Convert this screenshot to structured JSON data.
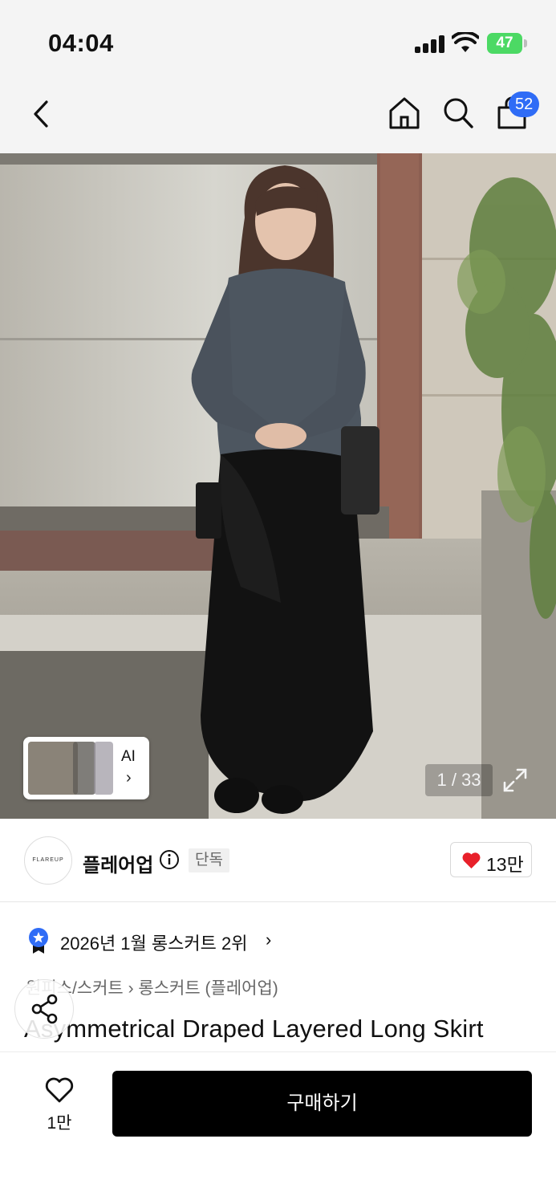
{
  "status_bar": {
    "time": "04:04",
    "battery": "47"
  },
  "nav": {
    "cart_count": "52",
    "icons": [
      "back-chevron-icon",
      "home-icon",
      "search-icon",
      "shopping-bag-icon"
    ]
  },
  "gallery": {
    "thumb_label": "AI",
    "thumb_chevron": "›",
    "counter": "1 / 33",
    "expand_icon": "expand-icon"
  },
  "seller": {
    "logo_text": "FLAREUP",
    "name": "플레어업",
    "exclusive_label": "단독",
    "like_count": "13만",
    "accent": "#e8202a"
  },
  "ranking": {
    "text": "2026년 1월 롱스커트 2위",
    "chevron": "›",
    "badge_color": "#2f6cf6"
  },
  "breadcrumb": "원피스/스커트 › 롱스커트 (플레어업)",
  "product": {
    "title": "Asymmetrical Draped Layered Long Skirt"
  },
  "bottom_bar": {
    "wish_count": "1만",
    "buy_label": "구매하기"
  }
}
